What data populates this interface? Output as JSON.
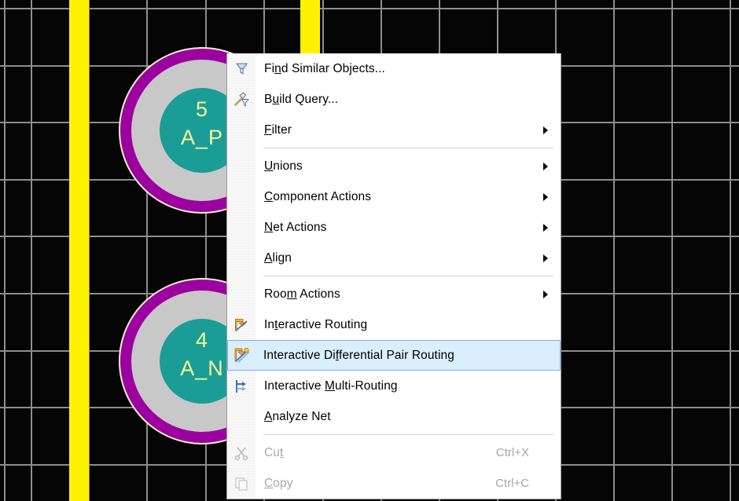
{
  "canvas": {
    "background_color": "#050505",
    "grid_color": "#8d8d8d",
    "trace_color": "#fff200",
    "pad_ring_color": "#9c00a0",
    "pad_plating_color": "#c8c8c8",
    "pad_hole_color": "#1a9d96",
    "pad_text_color": "#f7f79a",
    "pads": [
      {
        "designator": "5",
        "net": "A_P"
      },
      {
        "designator": "4",
        "net": "A_N"
      }
    ]
  },
  "context_menu": {
    "highlight_color": "#dbeefd",
    "highlight_border_color": "#7ab3e0",
    "items": [
      {
        "label": "Find Similar Objects...",
        "icon": "filter-funnel-icon",
        "accel": "n",
        "shortcut": "",
        "arrow": false,
        "disabled": false,
        "selected": false
      },
      {
        "label": "Build Query...",
        "icon": "build-query-icon",
        "accel": "u",
        "shortcut": "",
        "arrow": false,
        "disabled": false,
        "selected": false
      },
      {
        "label": "Filter",
        "icon": "",
        "accel": "F",
        "shortcut": "",
        "arrow": true,
        "disabled": false,
        "selected": false
      },
      {
        "label": "Unions",
        "icon": "",
        "accel": "U",
        "shortcut": "",
        "arrow": true,
        "disabled": false,
        "selected": false
      },
      {
        "label": "Component Actions",
        "icon": "",
        "accel": "C",
        "shortcut": "",
        "arrow": true,
        "disabled": false,
        "selected": false
      },
      {
        "label": "Net Actions",
        "icon": "",
        "accel": "N",
        "shortcut": "",
        "arrow": true,
        "disabled": false,
        "selected": false
      },
      {
        "label": "Align",
        "icon": "",
        "accel": "A",
        "shortcut": "",
        "arrow": true,
        "disabled": false,
        "selected": false
      },
      {
        "label": "Room Actions",
        "icon": "",
        "accel": "m",
        "shortcut": "",
        "arrow": true,
        "disabled": false,
        "selected": false
      },
      {
        "label": "Interactive Routing",
        "icon": "interactive-routing-icon",
        "accel": "t",
        "shortcut": "",
        "arrow": false,
        "disabled": false,
        "selected": false
      },
      {
        "label": "Interactive Differential Pair Routing",
        "icon": "differential-pair-routing-icon",
        "accel": "f",
        "shortcut": "",
        "arrow": false,
        "disabled": false,
        "selected": true
      },
      {
        "label": "Interactive Multi-Routing",
        "icon": "multi-routing-icon",
        "accel": "M",
        "shortcut": "",
        "arrow": false,
        "disabled": false,
        "selected": false
      },
      {
        "label": "Analyze Net",
        "icon": "",
        "accel": "A",
        "shortcut": "",
        "arrow": false,
        "disabled": false,
        "selected": false
      },
      {
        "label": "Cut",
        "icon": "scissors-icon",
        "accel": "t",
        "shortcut": "Ctrl+X",
        "arrow": false,
        "disabled": true,
        "selected": false
      },
      {
        "label": "Copy",
        "icon": "copy-icon",
        "accel": "C",
        "shortcut": "Ctrl+C",
        "arrow": false,
        "disabled": true,
        "selected": false
      }
    ],
    "separators_after": [
      2,
      6,
      11
    ]
  }
}
